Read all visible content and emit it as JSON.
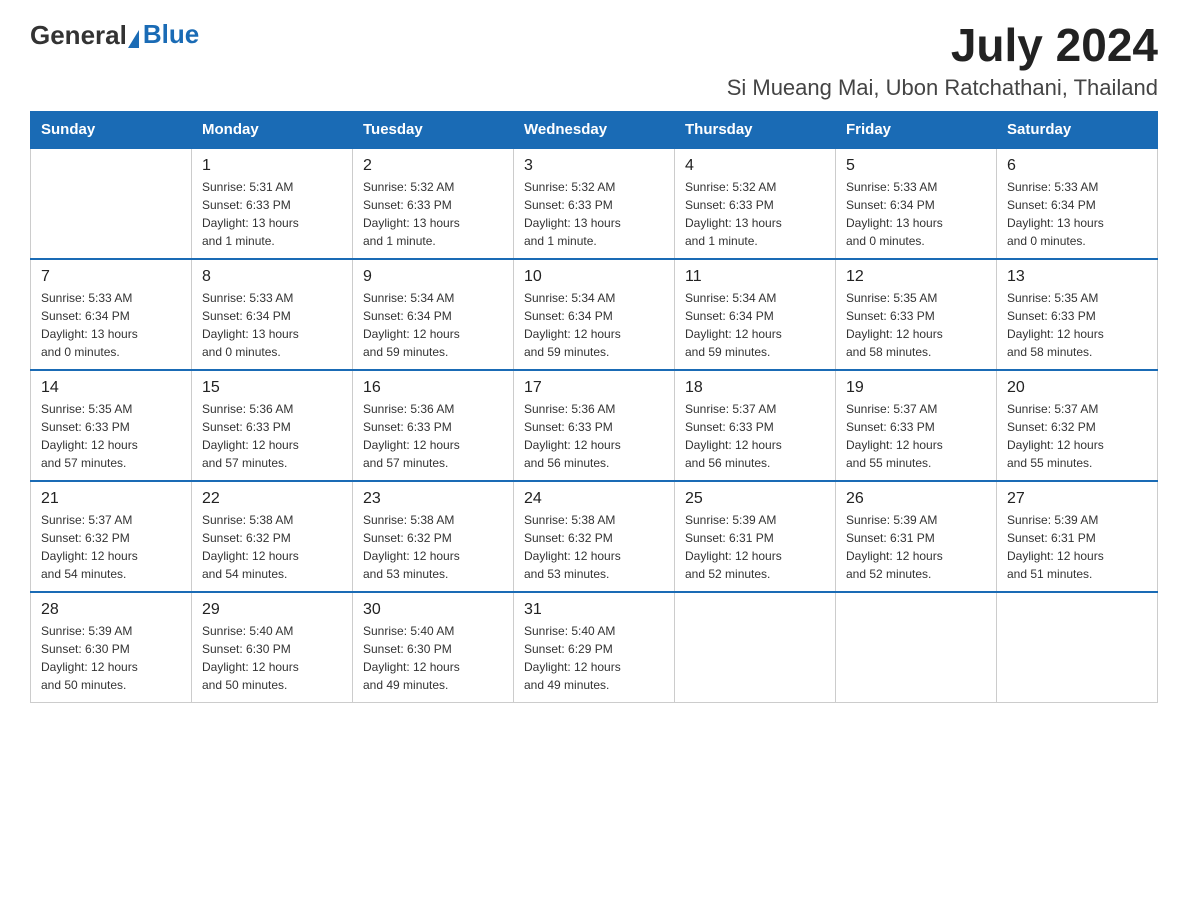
{
  "logo": {
    "general": "General",
    "blue": "Blue"
  },
  "title": "July 2024",
  "location": "Si Mueang Mai, Ubon Ratchathani, Thailand",
  "headers": [
    "Sunday",
    "Monday",
    "Tuesday",
    "Wednesday",
    "Thursday",
    "Friday",
    "Saturday"
  ],
  "weeks": [
    [
      {
        "day": "",
        "info": ""
      },
      {
        "day": "1",
        "info": "Sunrise: 5:31 AM\nSunset: 6:33 PM\nDaylight: 13 hours\nand 1 minute."
      },
      {
        "day": "2",
        "info": "Sunrise: 5:32 AM\nSunset: 6:33 PM\nDaylight: 13 hours\nand 1 minute."
      },
      {
        "day": "3",
        "info": "Sunrise: 5:32 AM\nSunset: 6:33 PM\nDaylight: 13 hours\nand 1 minute."
      },
      {
        "day": "4",
        "info": "Sunrise: 5:32 AM\nSunset: 6:33 PM\nDaylight: 13 hours\nand 1 minute."
      },
      {
        "day": "5",
        "info": "Sunrise: 5:33 AM\nSunset: 6:34 PM\nDaylight: 13 hours\nand 0 minutes."
      },
      {
        "day": "6",
        "info": "Sunrise: 5:33 AM\nSunset: 6:34 PM\nDaylight: 13 hours\nand 0 minutes."
      }
    ],
    [
      {
        "day": "7",
        "info": "Sunrise: 5:33 AM\nSunset: 6:34 PM\nDaylight: 13 hours\nand 0 minutes."
      },
      {
        "day": "8",
        "info": "Sunrise: 5:33 AM\nSunset: 6:34 PM\nDaylight: 13 hours\nand 0 minutes."
      },
      {
        "day": "9",
        "info": "Sunrise: 5:34 AM\nSunset: 6:34 PM\nDaylight: 12 hours\nand 59 minutes."
      },
      {
        "day": "10",
        "info": "Sunrise: 5:34 AM\nSunset: 6:34 PM\nDaylight: 12 hours\nand 59 minutes."
      },
      {
        "day": "11",
        "info": "Sunrise: 5:34 AM\nSunset: 6:34 PM\nDaylight: 12 hours\nand 59 minutes."
      },
      {
        "day": "12",
        "info": "Sunrise: 5:35 AM\nSunset: 6:33 PM\nDaylight: 12 hours\nand 58 minutes."
      },
      {
        "day": "13",
        "info": "Sunrise: 5:35 AM\nSunset: 6:33 PM\nDaylight: 12 hours\nand 58 minutes."
      }
    ],
    [
      {
        "day": "14",
        "info": "Sunrise: 5:35 AM\nSunset: 6:33 PM\nDaylight: 12 hours\nand 57 minutes."
      },
      {
        "day": "15",
        "info": "Sunrise: 5:36 AM\nSunset: 6:33 PM\nDaylight: 12 hours\nand 57 minutes."
      },
      {
        "day": "16",
        "info": "Sunrise: 5:36 AM\nSunset: 6:33 PM\nDaylight: 12 hours\nand 57 minutes."
      },
      {
        "day": "17",
        "info": "Sunrise: 5:36 AM\nSunset: 6:33 PM\nDaylight: 12 hours\nand 56 minutes."
      },
      {
        "day": "18",
        "info": "Sunrise: 5:37 AM\nSunset: 6:33 PM\nDaylight: 12 hours\nand 56 minutes."
      },
      {
        "day": "19",
        "info": "Sunrise: 5:37 AM\nSunset: 6:33 PM\nDaylight: 12 hours\nand 55 minutes."
      },
      {
        "day": "20",
        "info": "Sunrise: 5:37 AM\nSunset: 6:32 PM\nDaylight: 12 hours\nand 55 minutes."
      }
    ],
    [
      {
        "day": "21",
        "info": "Sunrise: 5:37 AM\nSunset: 6:32 PM\nDaylight: 12 hours\nand 54 minutes."
      },
      {
        "day": "22",
        "info": "Sunrise: 5:38 AM\nSunset: 6:32 PM\nDaylight: 12 hours\nand 54 minutes."
      },
      {
        "day": "23",
        "info": "Sunrise: 5:38 AM\nSunset: 6:32 PM\nDaylight: 12 hours\nand 53 minutes."
      },
      {
        "day": "24",
        "info": "Sunrise: 5:38 AM\nSunset: 6:32 PM\nDaylight: 12 hours\nand 53 minutes."
      },
      {
        "day": "25",
        "info": "Sunrise: 5:39 AM\nSunset: 6:31 PM\nDaylight: 12 hours\nand 52 minutes."
      },
      {
        "day": "26",
        "info": "Sunrise: 5:39 AM\nSunset: 6:31 PM\nDaylight: 12 hours\nand 52 minutes."
      },
      {
        "day": "27",
        "info": "Sunrise: 5:39 AM\nSunset: 6:31 PM\nDaylight: 12 hours\nand 51 minutes."
      }
    ],
    [
      {
        "day": "28",
        "info": "Sunrise: 5:39 AM\nSunset: 6:30 PM\nDaylight: 12 hours\nand 50 minutes."
      },
      {
        "day": "29",
        "info": "Sunrise: 5:40 AM\nSunset: 6:30 PM\nDaylight: 12 hours\nand 50 minutes."
      },
      {
        "day": "30",
        "info": "Sunrise: 5:40 AM\nSunset: 6:30 PM\nDaylight: 12 hours\nand 49 minutes."
      },
      {
        "day": "31",
        "info": "Sunrise: 5:40 AM\nSunset: 6:29 PM\nDaylight: 12 hours\nand 49 minutes."
      },
      {
        "day": "",
        "info": ""
      },
      {
        "day": "",
        "info": ""
      },
      {
        "day": "",
        "info": ""
      }
    ]
  ]
}
